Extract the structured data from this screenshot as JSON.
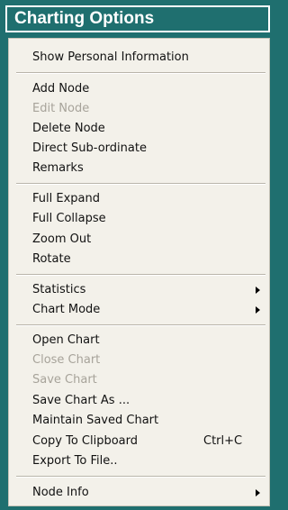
{
  "header": {
    "title": "Charting Options"
  },
  "menu": {
    "show_personal_info": "Show Personal Information",
    "add_node": "Add Node",
    "edit_node": "Edit Node",
    "delete_node": "Delete Node",
    "direct_subordinate": "Direct Sub-ordinate",
    "remarks": "Remarks",
    "full_expand": "Full Expand",
    "full_collapse": "Full Collapse",
    "zoom_out": "Zoom Out",
    "rotate": "Rotate",
    "statistics": "Statistics",
    "chart_mode": "Chart Mode",
    "open_chart": "Open Chart",
    "close_chart": "Close Chart",
    "save_chart": "Save Chart",
    "save_chart_as": "Save Chart As ...",
    "maintain_saved_chart": "Maintain Saved Chart",
    "copy_to_clipboard": "Copy To Clipboard",
    "copy_shortcut": "Ctrl+C",
    "export_to_file": "Export To File..",
    "node_info": "Node Info"
  },
  "colors": {
    "background": "#1f6f6f",
    "menu_bg": "#f3f1ea",
    "disabled_text": "#a7a39a"
  }
}
